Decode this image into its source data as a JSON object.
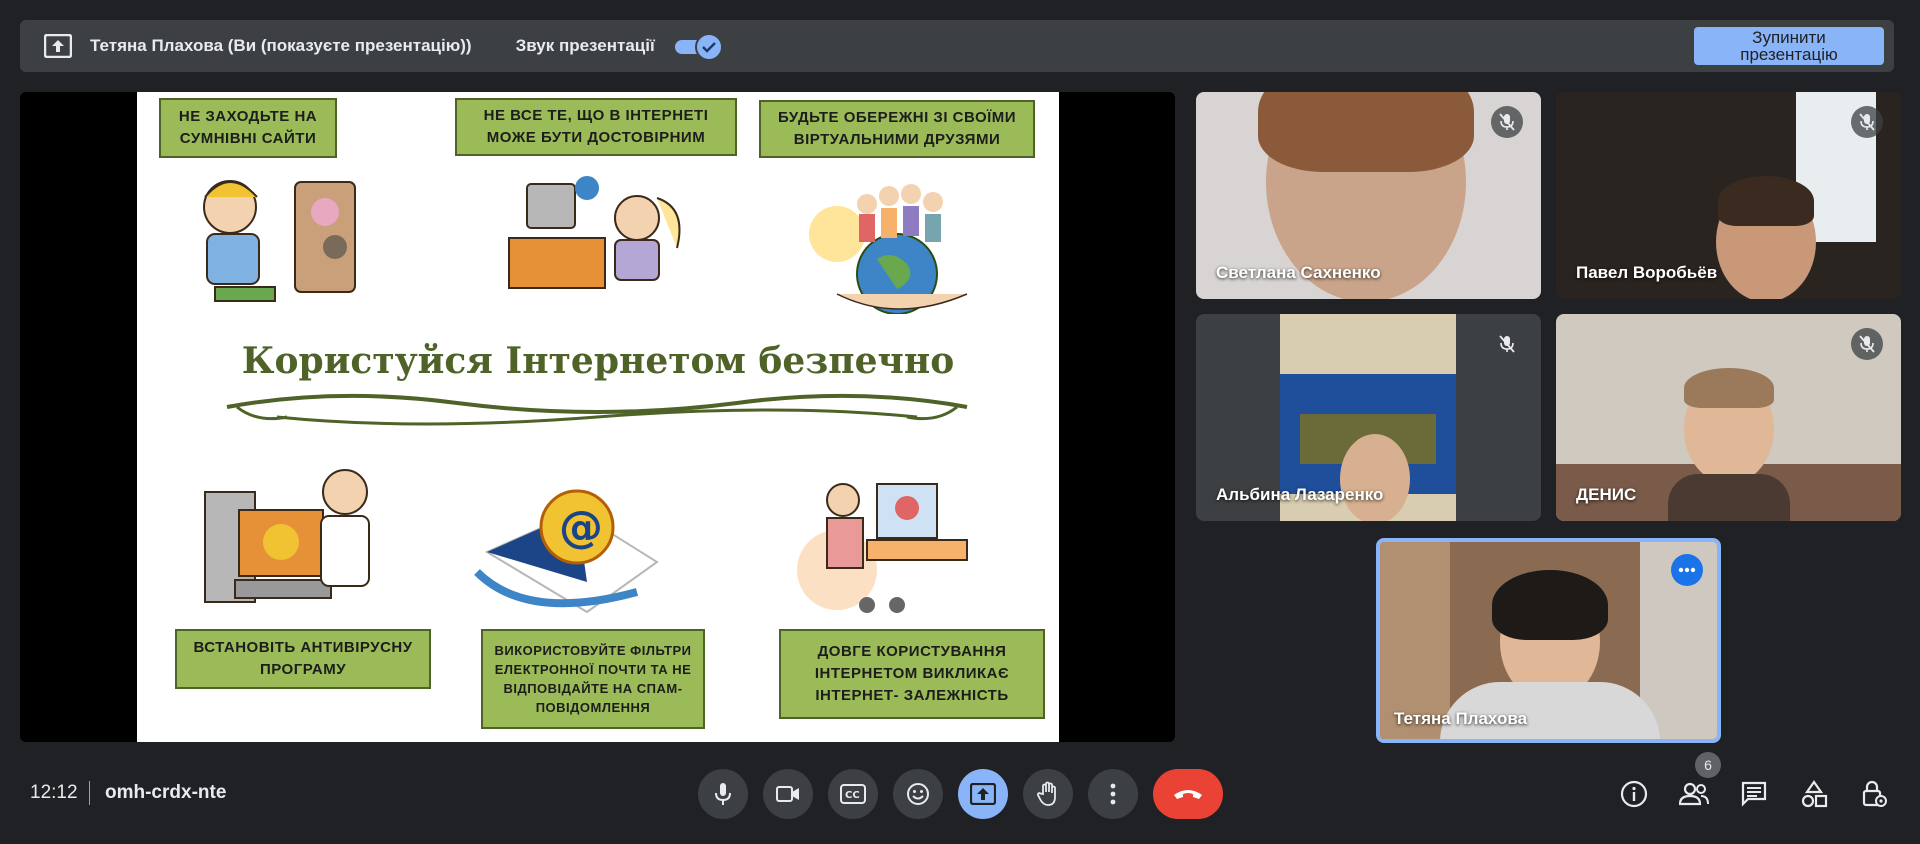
{
  "banner": {
    "presenter_text": "Тетяна Плахова (Ви (показуєте презентацію))",
    "sound_label": "Звук презентації",
    "sound_enabled": true,
    "stop_button_label": "Зупинити презентацію",
    "icon": "present-to-all-icon"
  },
  "slide": {
    "title": "Користуйся Інтернетом безпечно",
    "tips": [
      "НЕ ЗАХОДЬТЕ НА СУМНІВНІ САЙТИ",
      "НЕ ВСЕ ТЕ, ЩО В ІНТЕРНЕТІ МОЖЕ БУТИ ДОСТОВІРНИМ",
      "БУДЬТЕ ОБЕРЕЖНІ ЗІ СВОЇМИ ВІРТУАЛЬНИМИ ДРУЗЯМИ",
      "ВСТАНОВІТЬ АНТИВІРУСНУ ПРОГРАМУ",
      "ВИКОРИСТОВУЙТЕ ФІЛЬТРИ ЕЛЕКТРОННОЇ ПОЧТИ ТА НЕ ВІДПОВІДАЙТЕ НА СПАМ-ПОВІДОМЛЕННЯ",
      "ДОВГЕ КОРИСТУВАННЯ ІНТЕРНЕТОМ ВИКЛИКАЄ ІНТЕРНЕТ- ЗАЛЕЖНІСТЬ"
    ],
    "accent_color": "#9bbb59",
    "title_color": "#4f6228"
  },
  "participants": [
    {
      "name": "Светлана Сахненко",
      "muted": true
    },
    {
      "name": "Павел Воробьёв",
      "muted": true
    },
    {
      "name": "Альбина Лазаренко",
      "muted": true
    },
    {
      "name": "ДЕНИС",
      "muted": true
    },
    {
      "name": "Тетяна Плахова",
      "self": true
    }
  ],
  "bottom_bar": {
    "time": "12:12",
    "meeting_code": "omh-crdx-nte",
    "controls": [
      "mic-icon",
      "camera-icon",
      "captions-icon",
      "emoji-icon",
      "present-icon",
      "raise-hand-icon",
      "more-options-icon",
      "end-call-icon"
    ],
    "side_controls": [
      "info-icon",
      "people-icon",
      "chat-icon",
      "activities-icon",
      "host-controls-icon"
    ],
    "people_count": "6"
  },
  "colors": {
    "background": "#202124",
    "surface": "#3c4043",
    "accent": "#8ab4f8",
    "end_call": "#ea4335"
  }
}
